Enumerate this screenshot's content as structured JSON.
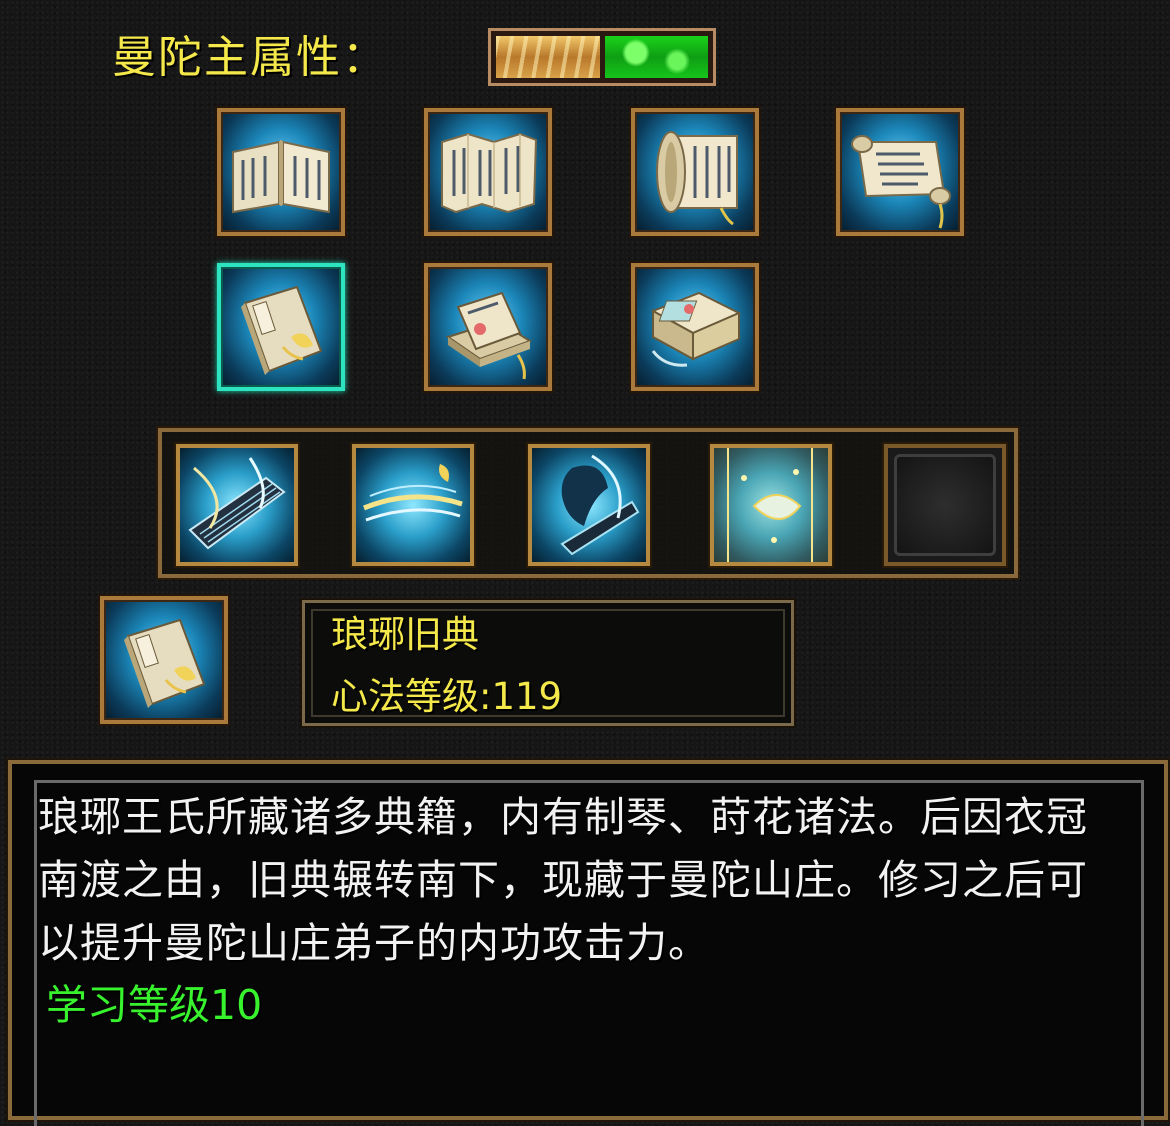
{
  "header": {
    "attribute_label": "曼陀主属性：",
    "attribute_colors": [
      "#d9a24a",
      "#16c41a"
    ]
  },
  "book_grid": {
    "items": [
      {
        "icon": "open-book-icon"
      },
      {
        "icon": "folded-manual-icon"
      },
      {
        "icon": "scroll-roll-icon"
      },
      {
        "icon": "unrolled-scroll-icon"
      },
      {
        "icon": "bound-book-icon",
        "selected": true
      },
      {
        "icon": "stacked-books-icon"
      },
      {
        "icon": "book-box-icon"
      }
    ]
  },
  "skills": {
    "items": [
      {
        "icon": "guqin-skill-icon"
      },
      {
        "icon": "wind-slash-skill-icon"
      },
      {
        "icon": "shadow-strike-skill-icon"
      },
      {
        "icon": "falling-petal-skill-icon"
      },
      {
        "icon": "empty-slot-icon",
        "empty": true
      }
    ]
  },
  "selected_item": {
    "icon": "bound-book-icon",
    "name": "琅琊旧典",
    "level_text": "心法等级:119"
  },
  "description": {
    "text": "琅琊王氏所藏诸多典籍，内有制琴、莳花诸法。后因衣冠南渡之由，旧典辗转南下，现藏于曼陀山庄。修习之后可以提升曼陀山庄弟子的内功攻击力。",
    "requirement": "学习等级10"
  },
  "colors": {
    "title_yellow": "#f4e84a",
    "requirement_green": "#38f22e",
    "frame_gold": "#a97a3c",
    "selected_border": "#2ee3c0"
  }
}
